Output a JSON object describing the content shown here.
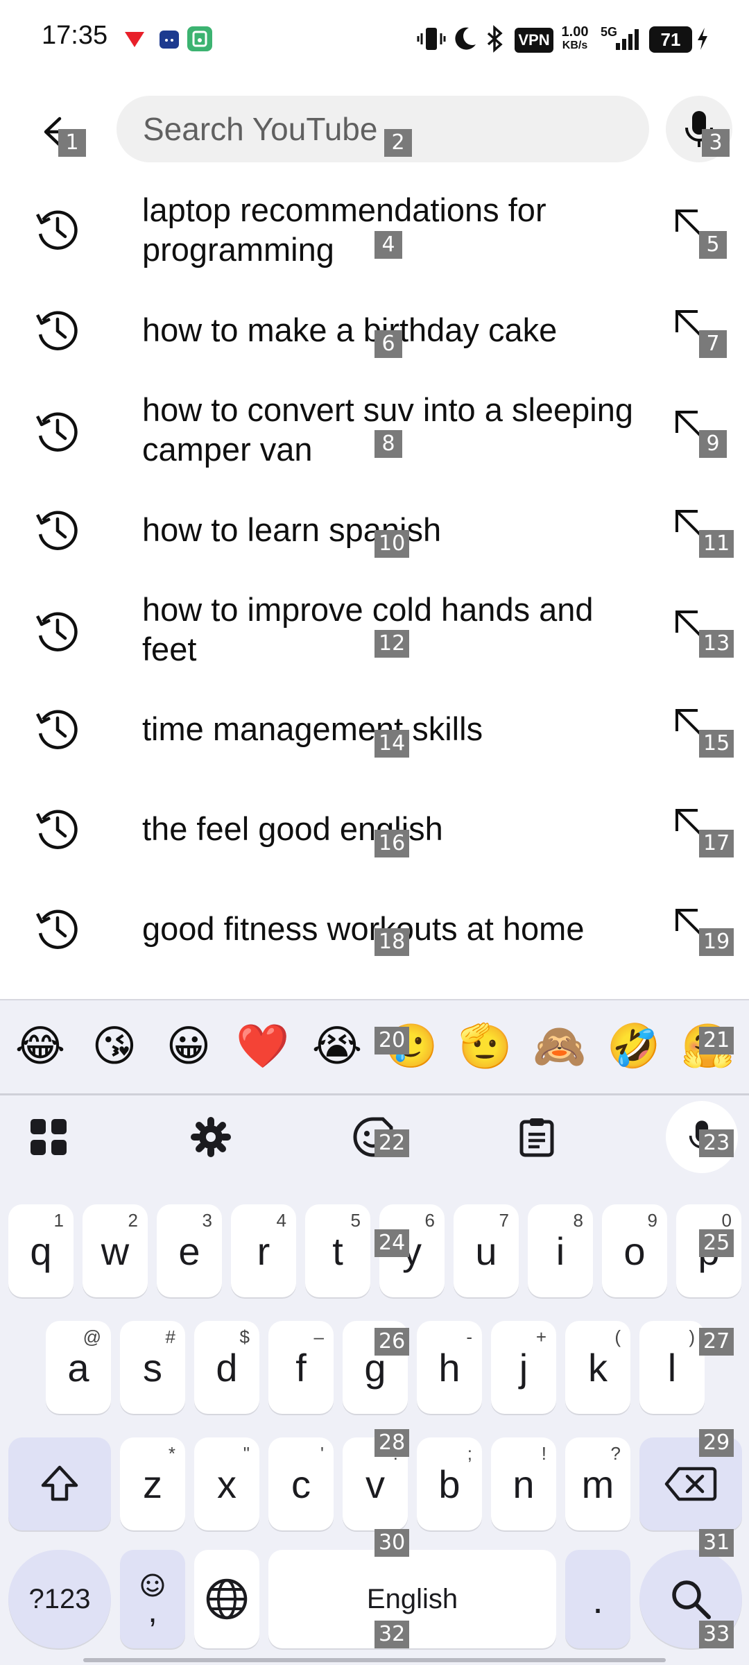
{
  "status_bar": {
    "time": "17:35",
    "network_speed_value": "1.00",
    "network_speed_unit": "KB/s",
    "network_type": "5G",
    "vpn_label": "VPN",
    "battery_level": "71"
  },
  "search": {
    "placeholder": "Search YouTube",
    "value": ""
  },
  "suggestions": [
    {
      "label": "laptop recommendations for programming"
    },
    {
      "label": "how to make a birthday cake"
    },
    {
      "label": "how to convert suv into a sleeping camper van"
    },
    {
      "label": "how to learn spanish"
    },
    {
      "label": "how to improve cold hands and feet"
    },
    {
      "label": "time management skills"
    },
    {
      "label": "the feel good english"
    },
    {
      "label": "good fitness workouts at home"
    }
  ],
  "emojis": [
    "😂",
    "😘",
    "😀",
    "❤️",
    "😭",
    "🥲",
    "🫡",
    "🙈",
    "🤣",
    "🤗"
  ],
  "keyboard": {
    "row1": [
      {
        "key": "q",
        "hint": "1"
      },
      {
        "key": "w",
        "hint": "2"
      },
      {
        "key": "e",
        "hint": "3"
      },
      {
        "key": "r",
        "hint": "4"
      },
      {
        "key": "t",
        "hint": "5"
      },
      {
        "key": "y",
        "hint": "6"
      },
      {
        "key": "u",
        "hint": "7"
      },
      {
        "key": "i",
        "hint": "8"
      },
      {
        "key": "o",
        "hint": "9"
      },
      {
        "key": "p",
        "hint": "0"
      }
    ],
    "row2": [
      {
        "key": "a",
        "hint": "@"
      },
      {
        "key": "s",
        "hint": "#"
      },
      {
        "key": "d",
        "hint": "$"
      },
      {
        "key": "f",
        "hint": "–"
      },
      {
        "key": "g",
        "hint": "&"
      },
      {
        "key": "h",
        "hint": "-"
      },
      {
        "key": "j",
        "hint": "+"
      },
      {
        "key": "k",
        "hint": "("
      },
      {
        "key": "l",
        "hint": ")"
      }
    ],
    "row3": [
      {
        "key": "z",
        "hint": "*"
      },
      {
        "key": "x",
        "hint": "\""
      },
      {
        "key": "c",
        "hint": "'"
      },
      {
        "key": "v",
        "hint": ":"
      },
      {
        "key": "b",
        "hint": ";"
      },
      {
        "key": "n",
        "hint": "!"
      },
      {
        "key": "m",
        "hint": "?"
      }
    ],
    "symbols_label": "?123",
    "comma_label": ",",
    "space_label": "English",
    "period_label": "."
  },
  "markers": [
    "1",
    "2",
    "3",
    "4",
    "5",
    "6",
    "7",
    "8",
    "9",
    "10",
    "11",
    "12",
    "13",
    "14",
    "15",
    "16",
    "17",
    "18",
    "19",
    "20",
    "21",
    "22",
    "23",
    "24",
    "25",
    "26",
    "27",
    "28",
    "29",
    "30",
    "31",
    "32",
    "33"
  ],
  "colors": {
    "search_bg": "#f0f0f0",
    "keyboard_bg": "#eff0f7",
    "modifier_key": "#dfe1f5",
    "marker_bg": "#7a7a7a"
  }
}
